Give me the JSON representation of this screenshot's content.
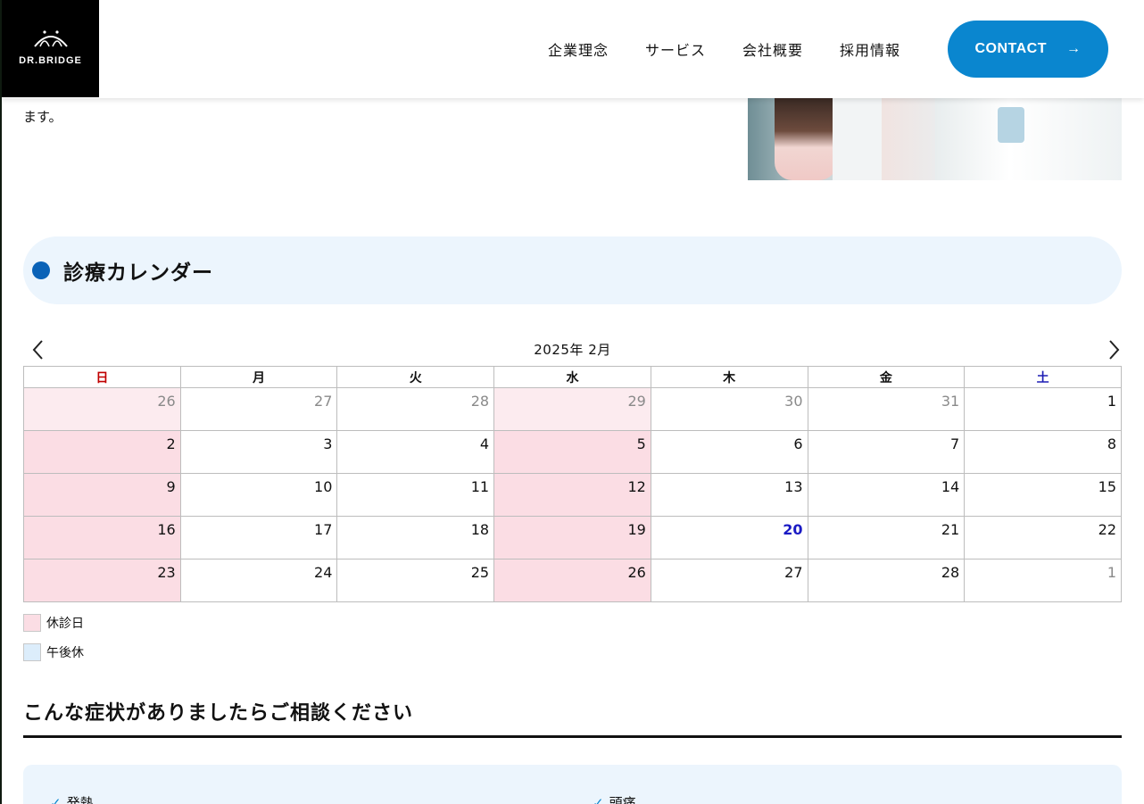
{
  "header": {
    "logo_text": "DR.BRIDGE",
    "nav": [
      "企業理念",
      "サービス",
      "会社概要",
      "採用情報"
    ],
    "contact_label": "CONTACT",
    "contact_icon": "arrow-right-icon"
  },
  "intro": {
    "text_tail": "ます。"
  },
  "calendar_section": {
    "title": "診療カレンダー",
    "month_label": "2025年 2月",
    "weekdays": [
      "日",
      "月",
      "火",
      "水",
      "木",
      "金",
      "土"
    ],
    "weeks": [
      [
        {
          "d": "26",
          "s": "closed-other"
        },
        {
          "d": "27",
          "s": "other"
        },
        {
          "d": "28",
          "s": "other"
        },
        {
          "d": "29",
          "s": "closed-other"
        },
        {
          "d": "30",
          "s": "other"
        },
        {
          "d": "31",
          "s": "other"
        },
        {
          "d": "1",
          "s": ""
        }
      ],
      [
        {
          "d": "2",
          "s": "closed"
        },
        {
          "d": "3",
          "s": ""
        },
        {
          "d": "4",
          "s": ""
        },
        {
          "d": "5",
          "s": "closed"
        },
        {
          "d": "6",
          "s": ""
        },
        {
          "d": "7",
          "s": ""
        },
        {
          "d": "8",
          "s": ""
        }
      ],
      [
        {
          "d": "9",
          "s": "closed"
        },
        {
          "d": "10",
          "s": ""
        },
        {
          "d": "11",
          "s": ""
        },
        {
          "d": "12",
          "s": "closed"
        },
        {
          "d": "13",
          "s": ""
        },
        {
          "d": "14",
          "s": ""
        },
        {
          "d": "15",
          "s": ""
        }
      ],
      [
        {
          "d": "16",
          "s": "closed"
        },
        {
          "d": "17",
          "s": ""
        },
        {
          "d": "18",
          "s": ""
        },
        {
          "d": "19",
          "s": "closed"
        },
        {
          "d": "20",
          "s": "today"
        },
        {
          "d": "21",
          "s": ""
        },
        {
          "d": "22",
          "s": ""
        }
      ],
      [
        {
          "d": "23",
          "s": "closed"
        },
        {
          "d": "24",
          "s": ""
        },
        {
          "d": "25",
          "s": ""
        },
        {
          "d": "26",
          "s": "closed"
        },
        {
          "d": "27",
          "s": ""
        },
        {
          "d": "28",
          "s": ""
        },
        {
          "d": "1",
          "s": "other"
        }
      ]
    ],
    "legend": [
      {
        "label": "休診日",
        "color": "#fbdde4"
      },
      {
        "label": "午後休",
        "color": "#dcedfb"
      }
    ]
  },
  "symptoms": {
    "title": "こんな症状がありましたらご相談ください",
    "items": [
      "発熱",
      "頭痛"
    ]
  },
  "colors": {
    "accent": "#0a86cf",
    "dot": "#0a62b7",
    "sunday": "#c00000",
    "saturday": "#1c1cb4",
    "today": "#1a1ac4"
  }
}
